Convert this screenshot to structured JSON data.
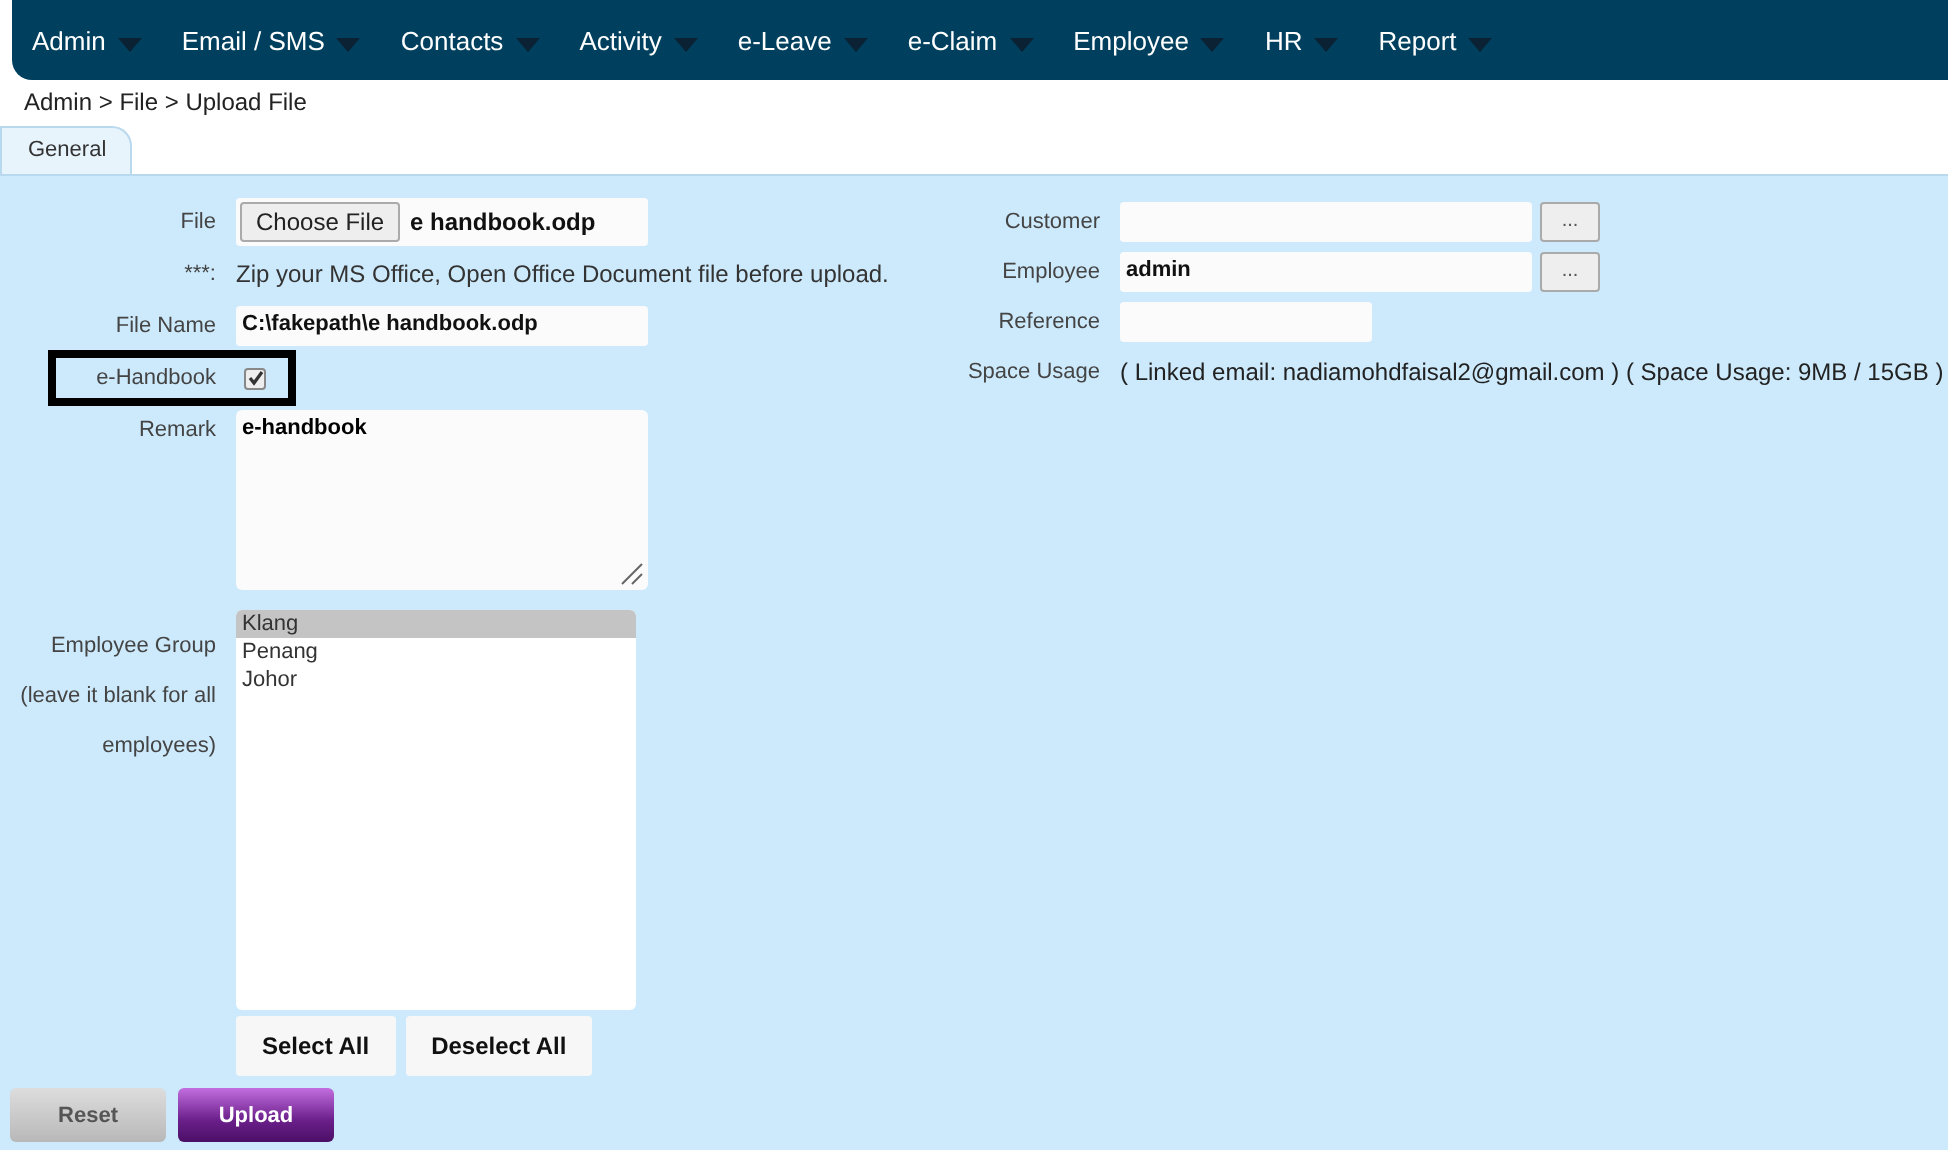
{
  "menu": [
    {
      "label": "Admin"
    },
    {
      "label": "Email / SMS"
    },
    {
      "label": "Contacts"
    },
    {
      "label": "Activity"
    },
    {
      "label": "e-Leave"
    },
    {
      "label": "e-Claim"
    },
    {
      "label": "Employee"
    },
    {
      "label": "HR"
    },
    {
      "label": "Report"
    }
  ],
  "breadcrumb": "Admin > File > Upload File",
  "tabs": [
    {
      "label": "General",
      "selected": true
    }
  ],
  "left": {
    "file": {
      "label": "File",
      "button": "Choose File",
      "value": "e handbook.odp"
    },
    "hint": {
      "label": "***:",
      "text": "Zip your MS Office, Open Office Document file before upload."
    },
    "file_name": {
      "label": "File Name",
      "value": "C:\\fakepath\\e handbook.odp"
    },
    "handbook": {
      "label": "e-Handbook",
      "checked": true,
      "highlighted": true
    },
    "remark": {
      "label": "Remark",
      "value": "e-handbook"
    },
    "employee_group": {
      "label_lines": [
        "Employee Group",
        "(leave it blank for all",
        "employees)"
      ],
      "options": [
        {
          "label": "Klang",
          "selected": true
        },
        {
          "label": "Penang",
          "selected": false
        },
        {
          "label": "Johor",
          "selected": false
        }
      ],
      "buttons": [
        "Select All",
        "Deselect All"
      ]
    }
  },
  "right": {
    "customer": {
      "label": "Customer",
      "browse": "..."
    },
    "employee": {
      "label": "Employee",
      "value": "admin",
      "browse": "..."
    },
    "reference": {
      "label": "Reference"
    },
    "space_usage": {
      "label": "Space Usage",
      "text": "( Linked email: nadiamohdfaisal2@gmail.com ) ( Space Usage: 9MB / 15GB )"
    }
  },
  "actions": [
    {
      "label": "Reset",
      "kind": "reset"
    },
    {
      "label": "Upload",
      "kind": "primary"
    }
  ]
}
